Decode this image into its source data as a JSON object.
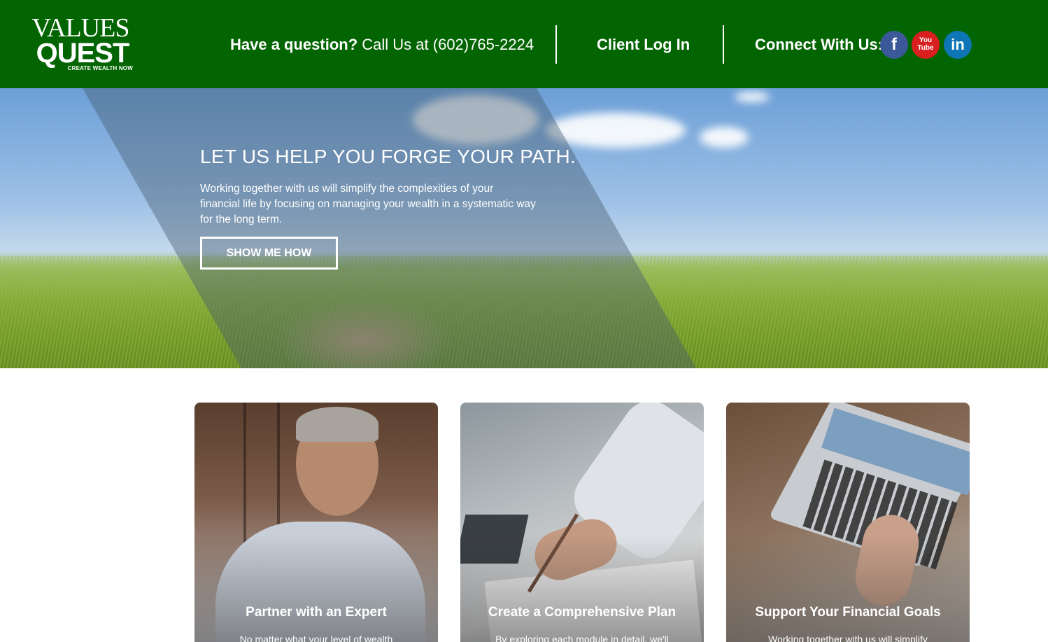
{
  "header": {
    "logo": {
      "line1": "VALUES",
      "line2": "QUEST",
      "tagline": "CREATE WEALTH NOW"
    },
    "question_label": "Have a question?",
    "call_text": "Call Us at (602)765-2224",
    "login_label": "Client Log In",
    "connect_label": "Connect With Us:",
    "social": [
      {
        "icon": "facebook-icon",
        "glyph": "f",
        "color": "#3b5998"
      },
      {
        "icon": "youtube-icon",
        "glyph1": "You",
        "glyph2": "Tube",
        "color": "#d91f1f"
      },
      {
        "icon": "linkedin-icon",
        "glyph": "in",
        "color": "#0e76b4"
      }
    ],
    "background": "#036502"
  },
  "hero": {
    "title": "LET US HELP YOU FORGE YOUR PATH.",
    "text": "Working together with us will simplify the complexities of your financial life by focusing on managing your wealth in a systematic way for the long term.",
    "button_label": "SHOW ME HOW"
  },
  "cards": [
    {
      "title": "Partner with an Expert",
      "text": "No matter what your level of wealth"
    },
    {
      "title": "Create a Comprehensive Plan",
      "text": "By exploring each module in detail, we'll"
    },
    {
      "title": "Support Your Financial Goals",
      "text": "Working together with us will simplify"
    }
  ]
}
